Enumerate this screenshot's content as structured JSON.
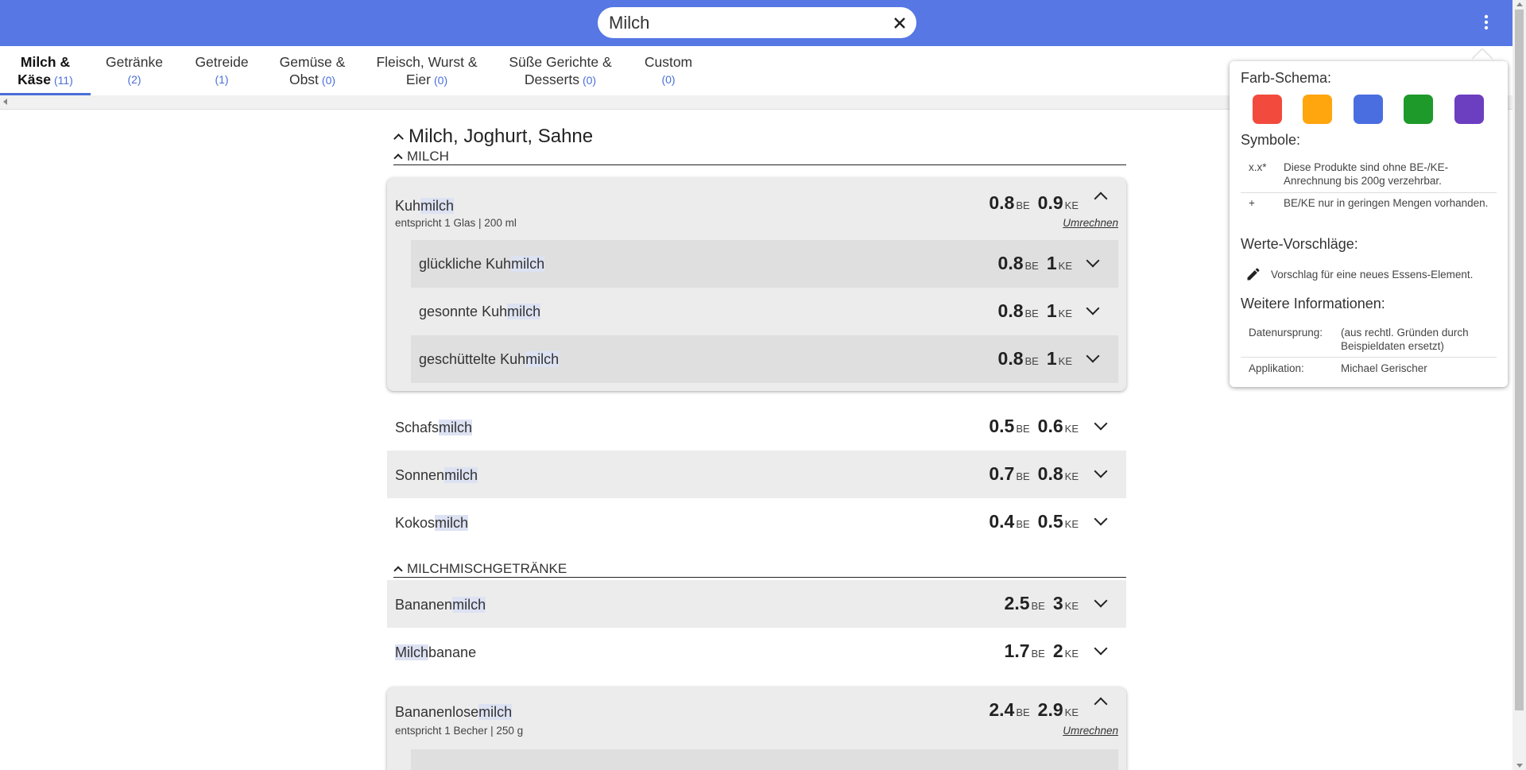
{
  "search": {
    "value": "Milch",
    "placeholder": ""
  },
  "tabs": [
    {
      "label": "Milch &",
      "label2": "Käse",
      "count": "(11)"
    },
    {
      "label": "Getränke",
      "label2": "",
      "count": "(2)"
    },
    {
      "label": "Getreide",
      "label2": "",
      "count": "(1)"
    },
    {
      "label": "Gemüse &",
      "label2": "Obst",
      "count": "(0)"
    },
    {
      "label": "Fleisch, Wurst &",
      "label2": "Eier",
      "count": "(0)"
    },
    {
      "label": "Süße Gerichte &",
      "label2": "Desserts",
      "count": "(0)"
    },
    {
      "label": "Custom",
      "label2": "",
      "count": "(0)"
    }
  ],
  "section": {
    "title": "Milch, Joghurt, Sahne",
    "groups": [
      {
        "title": "MILCH"
      },
      {
        "title": "MILCHMISCHGETRÄNKE"
      }
    ]
  },
  "units": {
    "be": "BE",
    "ke": "KE"
  },
  "convert_label": "Umrechnen",
  "items": {
    "kuhmilch": {
      "pre": "Kuh",
      "hl": "milch",
      "post": "",
      "sub": "entspricht 1 Glas | 200 ml",
      "be": "0.8",
      "ke": "0.9",
      "children": [
        {
          "pre": "glückliche Kuh",
          "hl": "milch",
          "post": "",
          "be": "0.8",
          "ke": "1"
        },
        {
          "pre": "gesonnte Kuh",
          "hl": "milch",
          "post": "",
          "be": "0.8",
          "ke": "1"
        },
        {
          "pre": "geschüttelte Kuh",
          "hl": "milch",
          "post": "",
          "be": "0.8",
          "ke": "1"
        }
      ]
    },
    "schafsmilch": {
      "pre": "Schafs",
      "hl": "milch",
      "post": "",
      "be": "0.5",
      "ke": "0.6"
    },
    "sonnenmilch": {
      "pre": "Sonnen",
      "hl": "milch",
      "post": "",
      "be": "0.7",
      "ke": "0.8"
    },
    "kokosmilch": {
      "pre": "Kokos",
      "hl": "milch",
      "post": "",
      "be": "0.4",
      "ke": "0.5"
    },
    "bananenmilch": {
      "pre": "Bananen",
      "hl": "milch",
      "post": "",
      "be": "2.5",
      "ke": "3"
    },
    "milchbanane": {
      "pre": "",
      "hl": "Milch",
      "post": "banane",
      "be": "1.7",
      "ke": "2"
    },
    "bananenlosemilch": {
      "pre": "Bananenlose",
      "hl": "milch",
      "post": "",
      "sub": "entspricht 1 Becher | 250 g",
      "be": "2.4",
      "ke": "2.9"
    }
  },
  "popup": {
    "color_scheme_title": "Farb-Schema:",
    "colors": [
      "#f24a3d",
      "#ffa50e",
      "#4a6ee0",
      "#1e9a2a",
      "#6c3ec0"
    ],
    "symbols_title": "Symbole:",
    "symbols": [
      {
        "key": "x.x*",
        "desc": "Diese Produkte sind ohne BE-/KE-Anrechnung bis 200g verzehrbar."
      },
      {
        "key": "+",
        "desc": "BE/KE nur in geringen Mengen vorhanden."
      }
    ],
    "suggestions_title": "Werte-Vorschläge:",
    "suggestion_text": "Vorschlag für eine neues Essens-Element.",
    "info_title": "Weitere Informationen:",
    "info": [
      {
        "key": "Datenursprung:",
        "value": "(aus rechtl. Gründen durch Beispieldaten ersetzt)"
      },
      {
        "key": "Applikation:",
        "value": "Michael Gerischer"
      }
    ]
  }
}
